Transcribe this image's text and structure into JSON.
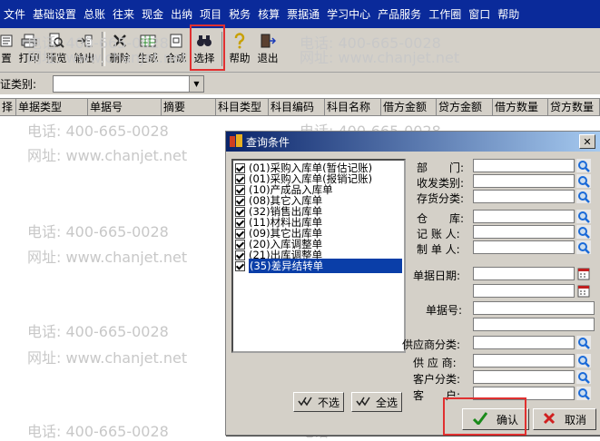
{
  "menubar": {
    "items": [
      "文件",
      "基础设置",
      "总账",
      "往来",
      "现金",
      "出纳",
      "项目",
      "税务",
      "核算",
      "票据通",
      "学习中心",
      "产品服务",
      "工作圈",
      "窗口",
      "帮助"
    ]
  },
  "toolbar": {
    "buttons": {
      "set": "置",
      "print": "打印",
      "preview": "预览",
      "export": "输出",
      "delete": "删除",
      "generate": "生成",
      "merge": "合成",
      "select": "选择",
      "help": "帮助",
      "exit": "退出"
    }
  },
  "voucher": {
    "label": "证类别:",
    "value": ""
  },
  "grid_headers": [
    "择",
    "单据类型",
    "单据号",
    "摘要",
    "科目类型",
    "科目编码",
    "科目名称",
    "借方金额",
    "贷方金额",
    "借方数量",
    "贷方数量"
  ],
  "watermark": {
    "phone": "电话: 400-665-0028",
    "site": "网址: www.chanjet.net"
  },
  "dialog": {
    "title": "查询条件",
    "list_items": [
      {
        "label": "(01)采购入库单(暂估记账)",
        "checked": true
      },
      {
        "label": "(01)采购入库单(报销记账)",
        "checked": true
      },
      {
        "label": "(10)产成品入库单",
        "checked": true
      },
      {
        "label": "(08)其它入库单",
        "checked": true
      },
      {
        "label": "(32)销售出库单",
        "checked": true
      },
      {
        "label": "(11)材料出库单",
        "checked": true
      },
      {
        "label": "(09)其它出库单",
        "checked": true
      },
      {
        "label": "(20)入库调整单",
        "checked": true
      },
      {
        "label": "(21)出库调整单",
        "checked": true
      },
      {
        "label": "(35)差异结转单",
        "checked": true
      }
    ],
    "fields": {
      "dept": "部　　门:",
      "rd_type": "收发类别:",
      "inv_class": "存货分类:",
      "warehouse": "仓　　库:",
      "bookkeeper": "记 账 人:",
      "maker": "制 单 人:",
      "doc_date": "单据日期:",
      "doc_no": "单据号:",
      "supplier_class": "供应商分类:",
      "supplier": "供 应 商:",
      "customer_class": "客户分类:",
      "customer": "客　　户:"
    },
    "buttons": {
      "deselect": "不选",
      "select_all": "全选",
      "confirm": "确认",
      "cancel": "取消"
    }
  },
  "colors": {
    "menubar": "#0a2a9a",
    "highlight": "#e03030",
    "selection": "#0a3ea8",
    "lookup": "#1a6ad8"
  }
}
